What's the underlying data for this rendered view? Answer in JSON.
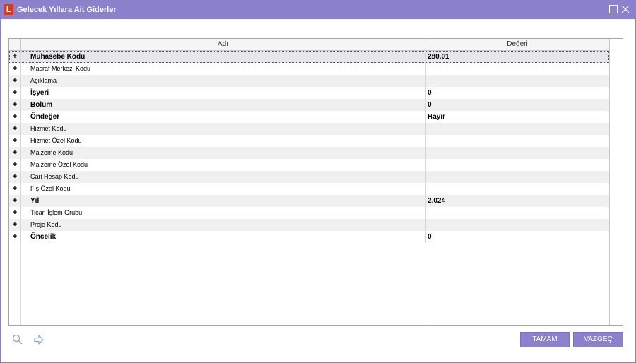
{
  "window": {
    "title": "Gelecek Yıllara Ait Giderler",
    "logo_letter": "L"
  },
  "grid": {
    "headers": {
      "name": "Adı",
      "value": "Değeri"
    },
    "rows": [
      {
        "expander": "+",
        "name": "Muhasebe Kodu",
        "value": "280.01",
        "bold": true
      },
      {
        "expander": "+",
        "name": "Masraf Merkezi Kodu",
        "value": "",
        "bold": false
      },
      {
        "expander": "+",
        "name": "Açıklama",
        "value": "",
        "bold": false
      },
      {
        "expander": "+",
        "name": "İşyeri",
        "value": "0",
        "bold": true
      },
      {
        "expander": "+",
        "name": "Bölüm",
        "value": "0",
        "bold": true
      },
      {
        "expander": "+",
        "name": "Öndeğer",
        "value": "Hayır",
        "bold": true
      },
      {
        "expander": "+",
        "name": "Hizmet Kodu",
        "value": "",
        "bold": false
      },
      {
        "expander": "+",
        "name": "Hizmet Özel Kodu",
        "value": "",
        "bold": false
      },
      {
        "expander": "+",
        "name": "Malzeme Kodu",
        "value": "",
        "bold": false
      },
      {
        "expander": "+",
        "name": "Malzeme Özel Kodu",
        "value": "",
        "bold": false
      },
      {
        "expander": "+",
        "name": "Cari Hesap Kodu",
        "value": "",
        "bold": false
      },
      {
        "expander": "+",
        "name": "Fiş Özel Kodu",
        "value": "",
        "bold": false
      },
      {
        "expander": "+",
        "name": "Yıl",
        "value": "2.024",
        "bold": true
      },
      {
        "expander": "+",
        "name": "Ticari İşlem Grubu",
        "value": "",
        "bold": false
      },
      {
        "expander": "+",
        "name": "Proje Kodu",
        "value": "",
        "bold": false
      },
      {
        "expander": "+",
        "name": "Öncelik",
        "value": "0",
        "bold": true
      }
    ]
  },
  "buttons": {
    "ok": "TAMAM",
    "cancel": "VAZGEÇ"
  },
  "icons": {
    "search": "search-icon",
    "navigate": "arrow-right-icon",
    "maximize": "maximize-icon",
    "close": "close-icon"
  },
  "colors": {
    "titlebar": "#8c81cd",
    "button": "#8c81cd",
    "logo": "#d93a1e"
  }
}
